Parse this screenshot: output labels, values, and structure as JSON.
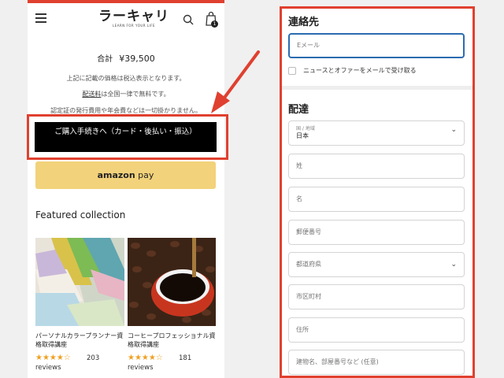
{
  "left": {
    "logo_main": "ラーキャリ",
    "logo_sub": "LEARN FOR YOUR LIFE",
    "cart_count": "1",
    "total_label": "合計",
    "total_amount": "¥39,500",
    "note_tax": "上記に記載の価格は税込表示となります。",
    "note_shipping_link": "配送料",
    "note_shipping_rest": "は全国一律で無料です。",
    "note_fee": "認定証の発行費用や年会費などは一切掛かりません。",
    "checkout_label": "ご購入手続きへ（カード・後払い・振込）",
    "amazon_label_a": "amazon",
    "amazon_label_b": " pay",
    "featured_title": "Featured collection",
    "products": [
      {
        "name": "パーソナルカラープランナー資格取得講座",
        "stars": "★★★★☆",
        "rating_count": "203",
        "reviews_label": "reviews"
      },
      {
        "name": "コーヒープロフェッショナル資格取得講座",
        "stars": "★★★★☆",
        "rating_count": "181",
        "reviews_label": "reviews"
      }
    ]
  },
  "right": {
    "contact_title": "連絡先",
    "email_placeholder": "Eメール",
    "newsletter_label": "ニュースとオファーをメールで受け取る",
    "delivery_title": "配達",
    "country_label": "国 / 地域",
    "country_value": "日本",
    "last_name": "姓",
    "first_name": "名",
    "postal_code": "郵便番号",
    "prefecture": "都道府県",
    "city": "市区町村",
    "address": "住所",
    "building": "建物名、部屋番号など (任意)"
  },
  "colors": {
    "accent_frame": "#e0402f",
    "amazon": "#f2d27a",
    "focus": "#2b6cb0"
  }
}
